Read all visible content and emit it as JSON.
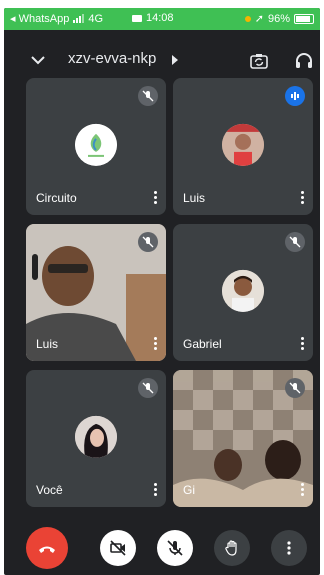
{
  "status_bar": {
    "back_app": "◂ WhatsApp",
    "network": "4G",
    "time": "14:08",
    "battery": "96%",
    "bg_color": "#3fc054"
  },
  "header": {
    "meeting_code": "xzv-evva-nkp",
    "icons": [
      "chevron-down-icon",
      "switch-camera-icon",
      "headset-icon"
    ]
  },
  "participants": [
    {
      "name": "Circuito",
      "mic": "muted",
      "avatar": "logo"
    },
    {
      "name": "Luis",
      "mic": "speaking",
      "avatar": "photo"
    },
    {
      "name": "Luis",
      "mic": "muted",
      "avatar": "video"
    },
    {
      "name": "Gabriel",
      "mic": "muted",
      "avatar": "photo"
    },
    {
      "name": "Você",
      "mic": "muted",
      "avatar": "photo"
    },
    {
      "name": "Gi",
      "mic": "muted",
      "avatar": "video"
    }
  ],
  "controls": {
    "hangup_color": "#ea4335",
    "items": [
      "hang-up",
      "camera-off",
      "mic-off",
      "raise-hand",
      "more-options"
    ]
  }
}
